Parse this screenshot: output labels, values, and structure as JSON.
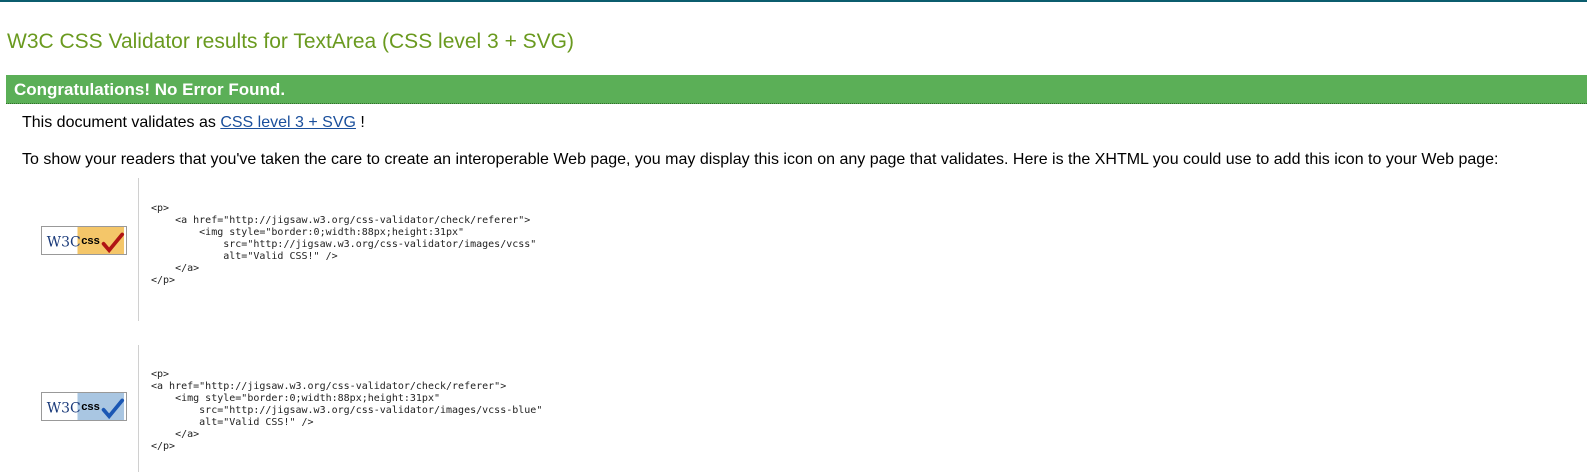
{
  "page": {
    "title": "W3C CSS Validator results for TextArea (CSS level 3 + SVG)"
  },
  "result": {
    "heading": "Congratulations! No Error Found.",
    "validates_prefix": "This document validates as",
    "profile_link": "CSS level 3 + SVG",
    "validates_suffix": "!"
  },
  "info": {
    "text": "To show your readers that you've taken the care to create an interoperable Web page, you may display this icon on any page that validates. Here is the XHTML you could use to add this icon to your Web page:"
  },
  "badges": [
    {
      "icon": "w3c-css-valid-gold-icon",
      "w3c_text": "W3C",
      "css_text": "css",
      "color": "#f4c669",
      "check_color": "#b01414",
      "code": "<p>\n    <a href=\"http://jigsaw.w3.org/css-validator/check/referer\">\n        <img style=\"border:0;width:88px;height:31px\"\n            src=\"http://jigsaw.w3.org/css-validator/images/vcss\"\n            alt=\"Valid CSS!\" />\n    </a>\n</p>"
    },
    {
      "icon": "w3c-css-valid-blue-icon",
      "w3c_text": "W3C",
      "css_text": "css",
      "color": "#a9c6e2",
      "check_color": "#1b57b4",
      "code": "<p>\n<a href=\"http://jigsaw.w3.org/css-validator/check/referer\">\n    <img style=\"border:0;width:88px;height:31px\"\n        src=\"http://jigsaw.w3.org/css-validator/images/vcss-blue\"\n        alt=\"Valid CSS!\" />\n    </a>\n</p>"
    }
  ],
  "colors": {
    "title": "#6a9a1f",
    "success_bar": "#5baf57",
    "link": "#1a4f9c"
  }
}
